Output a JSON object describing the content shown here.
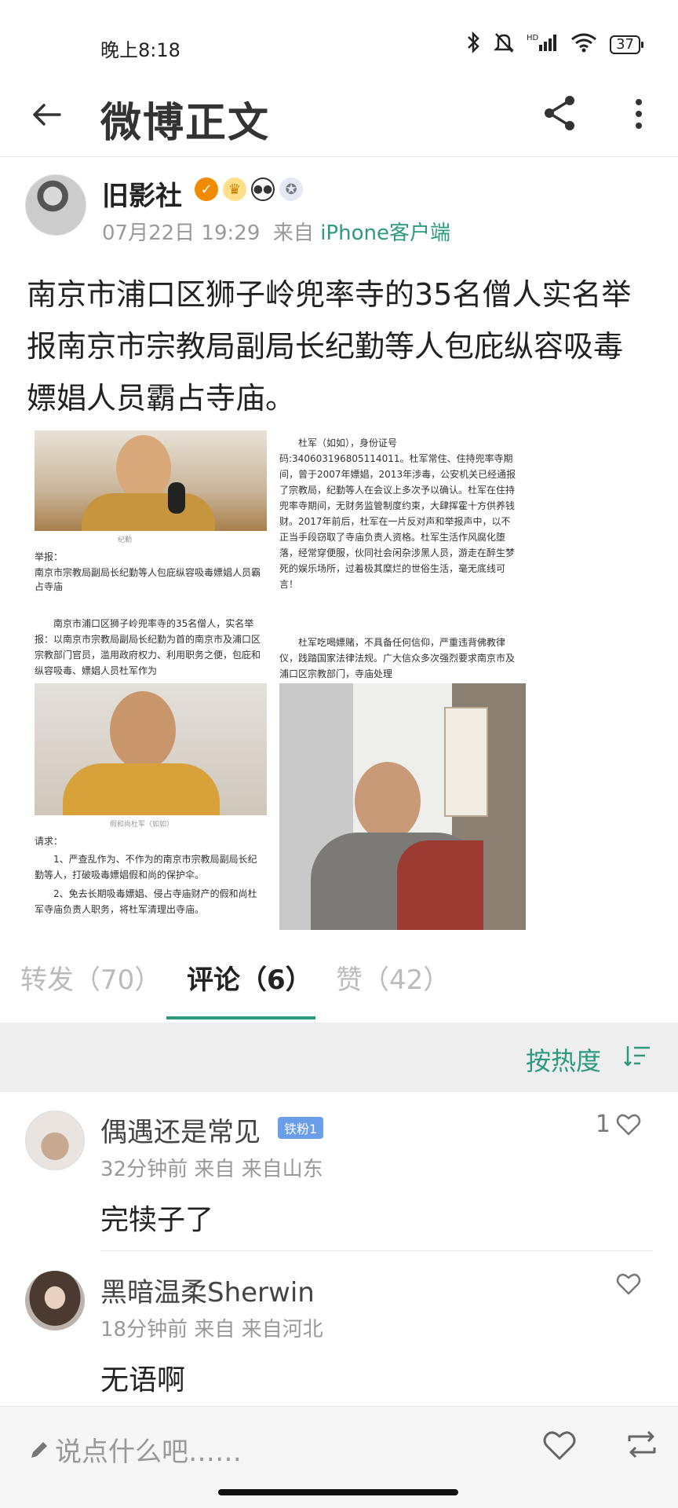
{
  "status_bar": {
    "time": "晚上8:18",
    "battery": "37"
  },
  "header": {
    "title": "微博正文"
  },
  "post": {
    "author": "旧影社",
    "date": "07月22日 19:29",
    "source_prefix": "来自",
    "source_client": "iPhone客户端",
    "text": "南京市浦口区狮子岭兜率寺的35名僧人实名举报南京市宗教局副局长纪勤等人包庇纵容吸毒嫖娼人员霸占寺庙。",
    "image_doc": {
      "caption1": "纪勤",
      "report_title": "举报：",
      "report_subject": "南京市宗教局副局长纪勤等人包庇纵容吸毒嫖娼人员霸占寺庙",
      "report_body": "南京市浦口区狮子岭兜率寺的35名僧人，实名举报：以南京市宗教局副局长纪勤为首的南京市及浦口区宗教部门官员，滥用政府权力、利用职务之便，包庇和纵容吸毒、嫖娼人员杜军作为",
      "caption2": "假和尚杜军（如如）",
      "request_title": "请求：",
      "request_1": "1、严查乱作为、不作为的南京市宗教局副局长纪勤等人，打破吸毒嫖娼假和尚的保护伞。",
      "request_2": "2、免去长期吸毒嫖娼、侵占寺庙财产的假和尚杜军寺庙负责人职务，将杜军清理出寺庙。"
    },
    "image_text": {
      "para1": "杜军（如如），身份证号码:340603196805114011。杜军常住、住持兜率寺期间，曾于2007年嫖娼，2013年涉毒，公安机关已经通报了宗教局，纪勤等人在会议上多次予以确认。杜军在住持兜率寺期间，无财务监管制度约束，大肆挥霍十方供养钱财。2017年前后，杜军在一片反对声和举报声中，以不正当手段窃取了寺庙负责人资格。杜军生活作风腐化堕落，经常穿便服，伙同社会闲杂涉黑人员，游走在醉生梦死的娱乐场所，过着极其糜烂的世俗生活，毫无底线可言！",
      "para2": "杜军吃喝嫖赌，不具备任何信仰，严重违背佛教律仪，践踏国家法律法规。广大信众多次强烈要求南京市及浦口区宗教部门，寺庙处理"
    }
  },
  "tabs": {
    "repost": "转发（70）",
    "comments": "评论（6）",
    "likes": "赞（42）"
  },
  "sort": {
    "label": "按热度"
  },
  "comments": [
    {
      "name": "偶遇还是常见",
      "badge": "铁粉1",
      "meta": "32分钟前 来自 来自山东",
      "text": "完犊子了",
      "likes": "1"
    },
    {
      "name": "黑暗温柔Sherwin",
      "meta": "18分钟前 来自 来自河北",
      "text": "无语啊",
      "likes": ""
    }
  ],
  "input": {
    "placeholder": "说点什么吧……"
  },
  "colors": {
    "accent": "#2c9a7f",
    "verified": "#f08a00"
  }
}
